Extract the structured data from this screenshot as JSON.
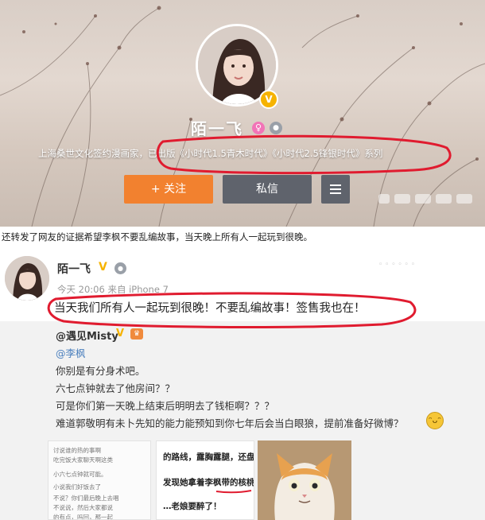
{
  "profile": {
    "name": "陌一飞",
    "description": "上海桑世文化签约漫画家，已出版《小时代1.5青木时代》《小时代2.5锋银时代》系列",
    "follow_label": "+ 关注",
    "message_label": "私信",
    "verified_badge": "V",
    "gender_icon": "female-icon",
    "level_icon": "level-icon",
    "more_icon": "menu-icon"
  },
  "caption": "还转发了网友的证据希望李枫不要乱编故事，当天晚上所有人一起玩到很晚。",
  "post": {
    "author": "陌一飞",
    "verified_badge": "V",
    "meta": "今天 20:06 来自 iPhone 7",
    "text": "当天我们所有人一起玩到很晚！不要乱编故事！签售我也在！",
    "repost": {
      "author": "@遇见Misty",
      "verified_badge": "V",
      "mention": "@李枫",
      "lines": [
        "你别是有分身术吧。",
        "六七点钟就去了他房间？？",
        "可是你们第一天晚上结束后明明去了钱柜啊？？？",
        "难道郭敬明有未卜先知的能力能预知到你七年后会当白眼狼，提前准备好微博？"
      ],
      "emoji_icon": "laughing-emoji-icon",
      "thumb_chat_lines": [
        "讨说谁的热的事啊",
        "吃完饭大家聊天啊这类",
        "小六七点钟就可能。",
        "小说我们好饭去了",
        "不说？你们最后晚上去唱",
        "不说说，然后大家都说",
        "的有点，吗回，那一起"
      ],
      "thumb_text_lines": [
        "的路线，露胸露腿，还盘了",
        "发现她拿着李枫带的核桃",
        "…老娘要醉了！"
      ]
    }
  },
  "colors": {
    "follow": "#f2812f",
    "dark_button": "#5f636c",
    "link": "#4a7fbd",
    "annotation": "#e01b2f",
    "verified": "#f6b300"
  }
}
